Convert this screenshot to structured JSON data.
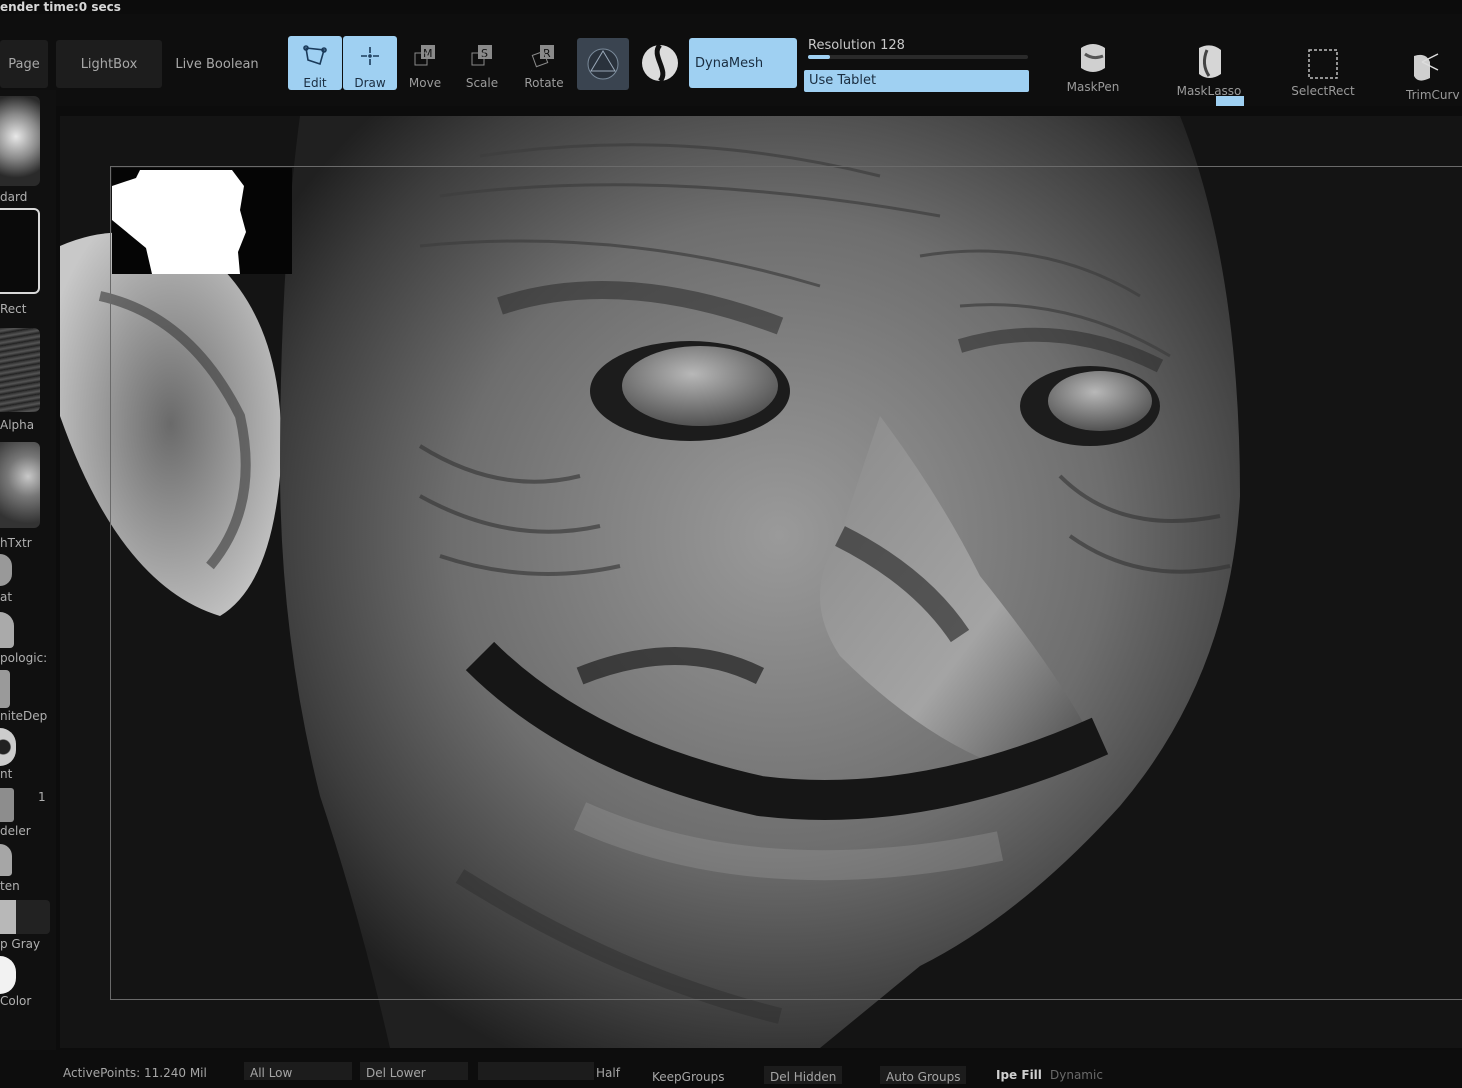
{
  "status": {
    "text": "ender time:0 secs"
  },
  "toolbar": {
    "page_tab": "Page",
    "lightbox": "LightBox",
    "live_boolean": "Live Boolean",
    "tools": [
      {
        "label": "Edit",
        "icon": "edit-icon",
        "active": true
      },
      {
        "label": "Draw",
        "icon": "draw-icon",
        "active": true
      },
      {
        "label": "Move",
        "icon": "move-icon",
        "active": false
      },
      {
        "label": "Scale",
        "icon": "scale-icon",
        "active": false
      },
      {
        "label": "Rotate",
        "icon": "rotate-icon",
        "active": false
      }
    ],
    "dynamesh": "DynaMesh",
    "resolution_label": "Resolution",
    "resolution_value": "128",
    "resolution_fraction": 0.1,
    "use_tablet": "Use Tablet",
    "brushes": [
      {
        "label": "MaskPen",
        "icon": "maskpen-icon"
      },
      {
        "label": "MaskLasso",
        "icon": "masklasso-icon"
      },
      {
        "label": "SelectRect",
        "icon": "selectrect-icon"
      },
      {
        "label": "TrimCurv",
        "icon": "trimcurve-icon"
      }
    ],
    "accent_color": "#9fd0f2"
  },
  "left_tray": {
    "items": [
      {
        "label": "dard"
      },
      {
        "label": "Rect"
      },
      {
        "label": "Alpha"
      },
      {
        "label": "hTxtr"
      },
      {
        "label": "at"
      },
      {
        "label": "pologic:"
      },
      {
        "label": "niteDep"
      },
      {
        "label": "nt"
      },
      {
        "label": "deler"
      },
      {
        "label": "ten"
      },
      {
        "label": "p Gray"
      },
      {
        "label": "Color"
      }
    ],
    "side_number": "1"
  },
  "viewport": {
    "subject": "sculpted goblin head"
  },
  "bottom_bar": {
    "active_points": "ActivePoints: 11.240 Mil",
    "all_low": "All Low",
    "del_lower": "Del Lower",
    "half": "Half",
    "keep_groups": "KeepGroups",
    "del_hidden": "Del Hidden",
    "auto_groups": "Auto Groups",
    "ipe_fill": "Ipe Fill",
    "dynamic": "Dynamic"
  }
}
